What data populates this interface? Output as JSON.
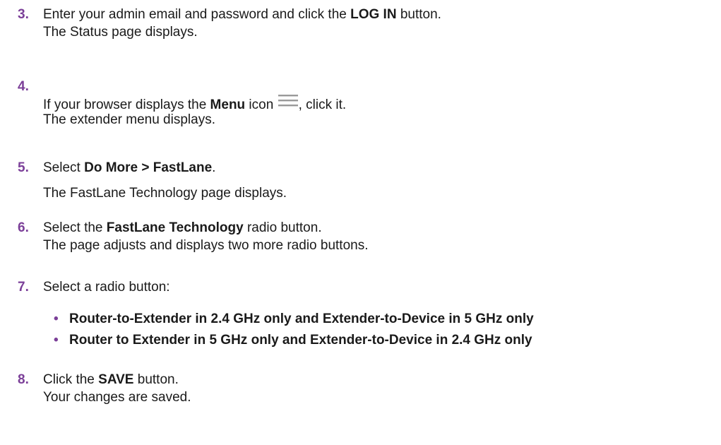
{
  "steps": [
    {
      "number": "3.",
      "line1": {
        "pre": "Enter your admin email and password and click the ",
        "bold": "LOG IN",
        "post": " button."
      },
      "line2": "The Status page displays."
    },
    {
      "number": "4.",
      "line1": {
        "pre": "If your browser displays the ",
        "bold": "Menu",
        "mid": " icon ",
        "post": ", click it."
      },
      "icon": "menu-icon",
      "line2": "The extender menu displays."
    },
    {
      "number": "5.",
      "line1": {
        "pre": "Select ",
        "bold": "Do More > FastLane",
        "post": "."
      },
      "line2": "The FastLane Technology page displays."
    },
    {
      "number": "6.",
      "line1": {
        "pre": "Select the ",
        "bold": "FastLane Technology",
        "post": " radio button."
      },
      "line2": "The page adjusts and displays two more radio buttons."
    },
    {
      "number": "7.",
      "line1": {
        "pre": "Select a radio button:"
      },
      "bullets": [
        "Router-to-Extender in 2.4 GHz only and Extender-to-Device in 5 GHz only",
        "Router to Extender in 5 GHz only and Extender-to-Device in 2.4 GHz only"
      ]
    },
    {
      "number": "8.",
      "line1": {
        "pre": "Click the ",
        "bold": "SAVE",
        "post": " button."
      },
      "line2": "Your changes are saved."
    }
  ],
  "colors": {
    "accent": "#7b3f98",
    "text": "#1a1a1a",
    "icon": "#9a9a9a"
  }
}
